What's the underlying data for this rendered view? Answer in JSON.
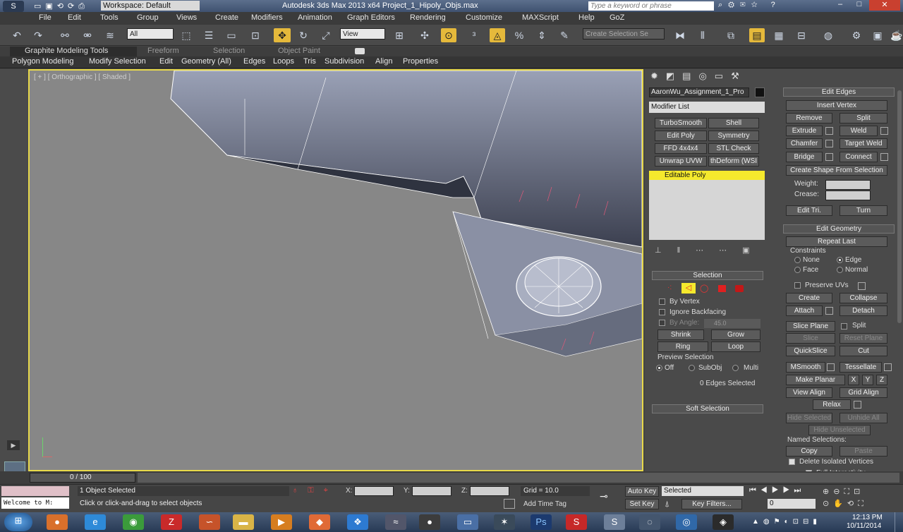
{
  "titlebar": {
    "workspace": "Workspace: Default",
    "title": "Autodesk 3ds Max  2013 x64     Project_1_Hipoly_Objs.max",
    "search_placeholder": "Type a keyword or phrase"
  },
  "menu": [
    "File",
    "Edit",
    "Tools",
    "Group",
    "Views",
    "Create",
    "Modifiers",
    "Animation",
    "Graph Editors",
    "Rendering",
    "Customize",
    "MAXScript",
    "Help",
    "GoZ"
  ],
  "toolbar": {
    "filter": "All",
    "refcoord": "View",
    "selset_placeholder": "Create Selection Se"
  },
  "ribbon_tabs": [
    "Graphite Modeling Tools",
    "Freeform",
    "Selection",
    "Object Paint"
  ],
  "ribbon_panels": [
    "Polygon Modeling",
    "Modify Selection",
    "Edit",
    "Geometry (All)",
    "Edges",
    "Loops",
    "Tris",
    "Subdivision",
    "Align",
    "Properties"
  ],
  "viewport": {
    "label": "[ + ] [ Orthographic ] [ Shaded ]"
  },
  "cmd": {
    "object_name": "AaronWu_Assignment_1_Pro",
    "modifier_list": "Modifier List",
    "mod_buttons": [
      "TurboSmooth",
      "Shell",
      "Edit Poly",
      "Symmetry",
      "FFD 4x4x4",
      "STL Check",
      "Unwrap UVW",
      "thDeform (WSI"
    ],
    "stack_item": "Editable Poly"
  },
  "selection": {
    "title": "Selection",
    "by_vertex": "By Vertex",
    "ignore_backfacing": "Ignore Backfacing",
    "by_angle": "By Angle:",
    "angle_value": "45.0",
    "shrink": "Shrink",
    "grow": "Grow",
    "ring": "Ring",
    "loop": "Loop",
    "preview": "Preview Selection",
    "off": "Off",
    "subobj": "SubObj",
    "multi": "Multi",
    "status": "0 Edges Selected",
    "soft": "Soft Selection"
  },
  "edit_edges": {
    "title": "Edit Edges",
    "insert_vertex": "Insert Vertex",
    "remove": "Remove",
    "split": "Split",
    "extrude": "Extrude",
    "weld": "Weld",
    "chamfer": "Chamfer",
    "target_weld": "Target Weld",
    "bridge": "Bridge",
    "connect": "Connect",
    "create_shape": "Create Shape From Selection",
    "weight": "Weight:",
    "crease": "Crease:",
    "edit_tri": "Edit Tri.",
    "turn": "Turn"
  },
  "edit_geometry": {
    "title": "Edit Geometry",
    "repeat_last": "Repeat Last",
    "constraints": "Constraints",
    "none": "None",
    "edge": "Edge",
    "face": "Face",
    "normal": "Normal",
    "preserve_uvs": "Preserve UVs",
    "create": "Create",
    "collapse": "Collapse",
    "attach": "Attach",
    "detach": "Detach",
    "slice_plane": "Slice Plane",
    "split": "Split",
    "slice": "Slice",
    "reset_plane": "Reset Plane",
    "quickslice": "QuickSlice",
    "cut": "Cut",
    "msmooth": "MSmooth",
    "tessellate": "Tessellate",
    "make_planar": "Make Planar",
    "x": "X",
    "y": "Y",
    "z": "Z",
    "view_align": "View Align",
    "grid_align": "Grid Align",
    "relax": "Relax",
    "hide_selected": "Hide Selected",
    "unhide_all": "Unhide All",
    "hide_unselected": "Hide Unselected",
    "named_selections": "Named Selections:",
    "copy": "Copy",
    "paste": "Paste",
    "delete_isolated": "Delete Isolated Vertices",
    "full_interactivity": "Full Interactivity"
  },
  "timeline": {
    "frame": "0 / 100"
  },
  "status": {
    "welcome": "Welcome to M:",
    "selected": "1 Object Selected",
    "prompt": "Click or click-and-drag to select objects",
    "x": "X:",
    "y": "Y:",
    "z": "Z:",
    "grid": "Grid = 10.0",
    "add_time_tag": "Add Time Tag",
    "auto_key": "Auto Key",
    "set_key": "Set Key",
    "key_mode": "Selected",
    "key_filters": "Key Filters...",
    "frame_field": "0"
  },
  "taskbar": {
    "time": "12:13 PM",
    "date": "10/11/2014"
  }
}
